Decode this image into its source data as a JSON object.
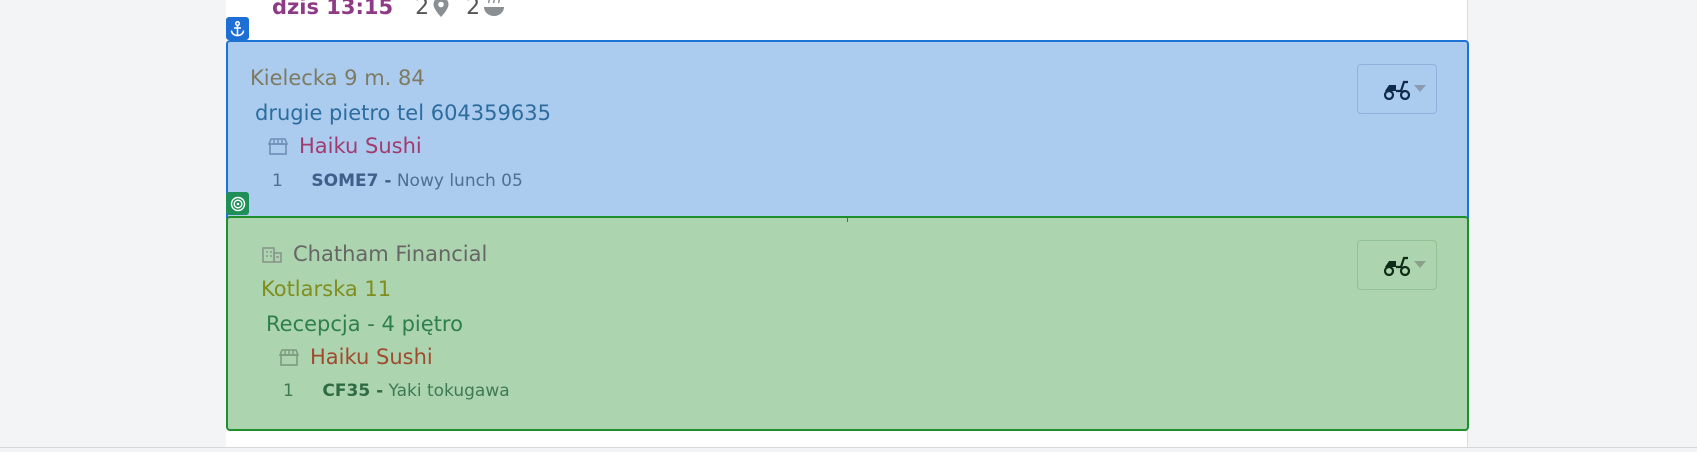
{
  "top_row": {
    "time": "dzis 13:15",
    "locations_count": "2",
    "meals_count": "2"
  },
  "orders": [
    {
      "address": "Kielecka 9 m. 84",
      "note": "drugie pietro tel 604359635",
      "restaurant": "Haiku Sushi",
      "items": [
        {
          "qty": "1",
          "code": "SOME7 -",
          "name": "Nowy lunch 05"
        }
      ],
      "color": "#abcbef"
    },
    {
      "company": "Chatham Financial",
      "address": "Kotlarska 11",
      "note": "Recepcja - 4 piętro",
      "restaurant": "Haiku Sushi",
      "items": [
        {
          "qty": "1",
          "code": "CF35 -",
          "name": "Yaki tokugawa"
        }
      ],
      "color": "#acd4ae"
    }
  ],
  "icons": {
    "anchor": "anchor-icon",
    "target": "target-icon",
    "location": "map-pin-icon",
    "meal": "bowl-icon",
    "store": "store-icon",
    "building": "building-icon",
    "scooter": "scooter-icon"
  }
}
